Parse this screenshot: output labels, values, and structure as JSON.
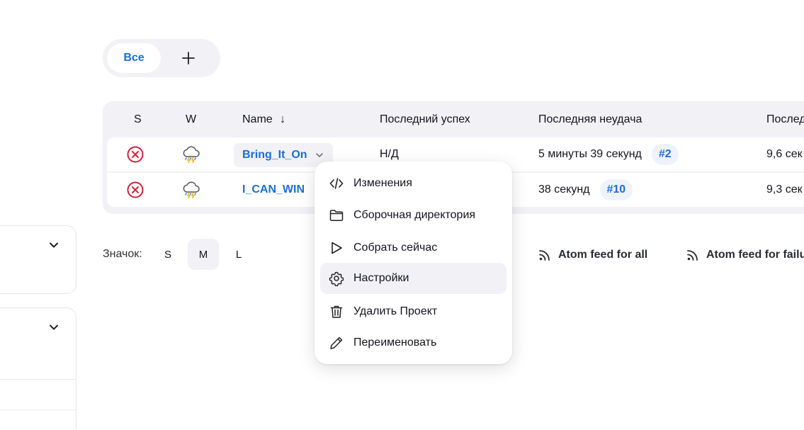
{
  "tabs": {
    "all_label": "Все",
    "add_label": "+"
  },
  "table": {
    "headers": {
      "s": "S",
      "w": "W",
      "name": "Name",
      "sort_arrow": "↓",
      "last_success": "Последний успех",
      "last_failure": "Последняя неудача",
      "last_duration": "Послед"
    },
    "rows": [
      {
        "status_icon": "failed-icon",
        "weather_icon": "storm-icon",
        "name": "Bring_It_On",
        "last_success": "Н/Д",
        "last_failure": "5 минуты 39 секунд",
        "failure_build": "#2",
        "duration": "9,6 сек"
      },
      {
        "status_icon": "failed-icon",
        "weather_icon": "storm-icon",
        "name": "I_CAN_WIN",
        "last_success": "",
        "last_failure": "38 секунд",
        "failure_build": "#10",
        "duration": "9,3 сек"
      }
    ]
  },
  "icon_size": {
    "label": "Значок:",
    "options": [
      "S",
      "M",
      "L"
    ],
    "selected": "M"
  },
  "feeds": {
    "all": "Atom feed for all",
    "failures": "Atom feed for failu"
  },
  "menu": {
    "items": [
      {
        "label": "Изменения",
        "icon": "code-icon"
      },
      {
        "label": "Сборочная директория",
        "icon": "folder-icon"
      },
      {
        "label": "Собрать сейчас",
        "icon": "play-icon"
      },
      {
        "label": "Настройки",
        "icon": "gear-icon"
      },
      {
        "label": "Удалить Проект",
        "icon": "trash-icon"
      },
      {
        "label": "Переименовать",
        "icon": "pencil-icon"
      }
    ],
    "hovered_index": 3
  },
  "colors": {
    "accent": "#1b6ed6",
    "failure": "#d2213a",
    "surface": "#f1f1f6"
  }
}
